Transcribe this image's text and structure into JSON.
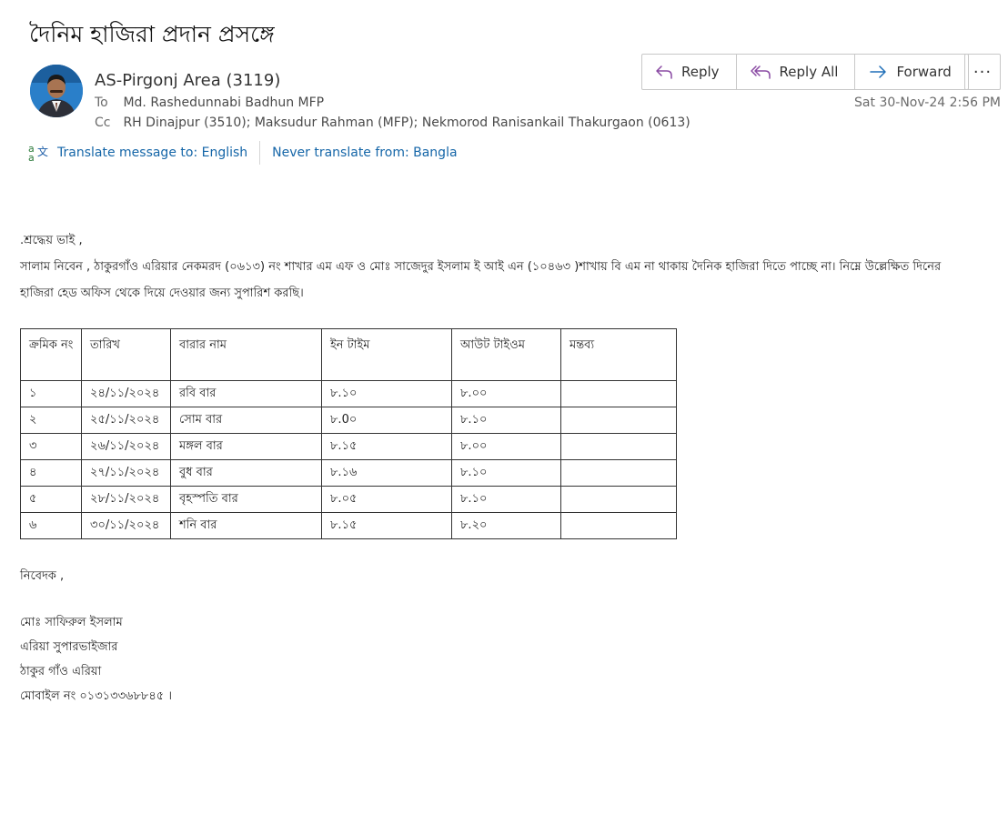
{
  "subject": "দৈনিম হাজিরা প্রদান প্রসঙ্গে",
  "sender": "AS-Pirgonj Area (3119)",
  "to_label": "To",
  "to": "Md. Rashedunnabi Badhun MFP",
  "cc_label": "Cc",
  "cc": "RH Dinajpur (3510); Maksudur Rahman (MFP); Nekmorod  Ranisankail Thakurgaon (0613)",
  "actions": {
    "reply": "Reply",
    "reply_all": "Reply All",
    "forward": "Forward",
    "more": "···"
  },
  "date": "Sat 30-Nov-24 2:56 PM",
  "translate": {
    "to": "Translate message to: English",
    "never": "Never translate from: Bangla"
  },
  "body": {
    "greeting": ".শ্রদ্ধেয় ভাই ,",
    "line1": "সালাম নিবেন , ঠাকুরগাঁও  এরিয়ার নেকমরদ (০৬১৩) নং শাখার এম এফ  ও মোঃ সাজেদুর ইসলাম  ই আই এন (১০৪৬৩ )শাখায় বি এম না থাকায় দৈনিক হাজিরা দিতে পাচ্ছে না। নিম্নে উল্লেক্ষিত দিনের",
    "line2": "হাজিরা হেড অফিস থেকে দিয়ে দেওয়ার জন্য সুপারিশ করছি।"
  },
  "table": {
    "headers": [
      "ক্রমিক নং",
      "তারিখ",
      "বারার নাম",
      "ইন টাইম",
      "আউট টাইওম",
      "মন্তব্য"
    ],
    "rows": [
      [
        "১",
        "২৪/১১/২০২৪",
        "রবি বার",
        "৮.১০",
        "৮.০০",
        ""
      ],
      [
        "২",
        "২৫/১১/২০২৪",
        "সোম বার",
        "৮.0০",
        "৮.১০",
        ""
      ],
      [
        "৩",
        "২৬/১১/২০২৪",
        "মঙ্গল বার",
        "৮.১৫",
        "৮.০০",
        ""
      ],
      [
        "৪",
        "২৭/১১/২০২৪",
        "বুধ বার",
        "৮.১৬",
        "৮.১০",
        ""
      ],
      [
        "৫",
        "২৮/১১/২০২৪",
        "বৃহস্পতি বার",
        "৮.০৫",
        "৮.১০",
        ""
      ],
      [
        "৬",
        "৩০/১১/২০২৪",
        "শনি বার",
        "৮.১৫",
        "৮.২০",
        ""
      ]
    ]
  },
  "signature": {
    "closing": "নিবেদক ,",
    "name": "মোঃ সাফিরুল ইসলাম",
    "title": "এরিয়া সুপারভাইজার",
    "area": "ঠাকুর গাঁও এরিয়া",
    "mobile": "মোবাইল নং ০১৩১৩৩৬৮৮৪৫ ।"
  }
}
